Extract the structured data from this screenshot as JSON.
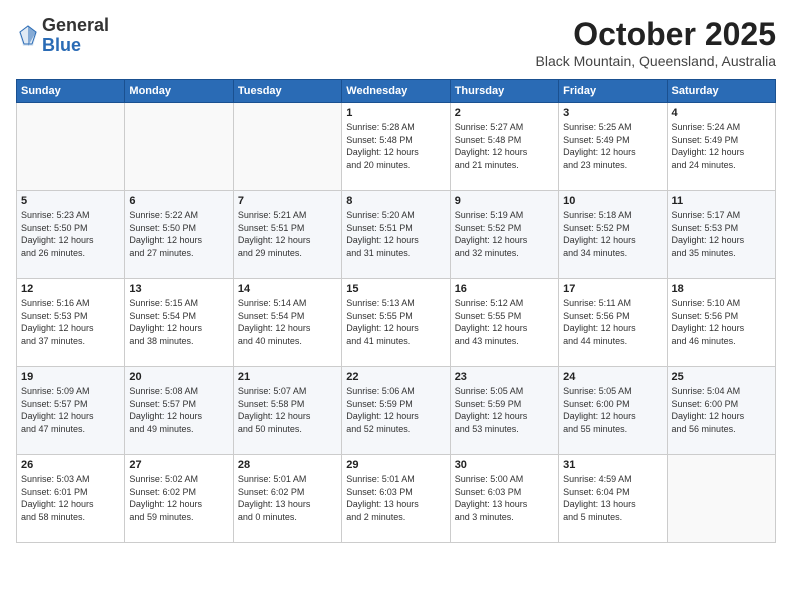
{
  "header": {
    "logo_general": "General",
    "logo_blue": "Blue",
    "month": "October 2025",
    "location": "Black Mountain, Queensland, Australia"
  },
  "days_of_week": [
    "Sunday",
    "Monday",
    "Tuesday",
    "Wednesday",
    "Thursday",
    "Friday",
    "Saturday"
  ],
  "weeks": [
    [
      {
        "day": "",
        "info": ""
      },
      {
        "day": "",
        "info": ""
      },
      {
        "day": "",
        "info": ""
      },
      {
        "day": "1",
        "info": "Sunrise: 5:28 AM\nSunset: 5:48 PM\nDaylight: 12 hours\nand 20 minutes."
      },
      {
        "day": "2",
        "info": "Sunrise: 5:27 AM\nSunset: 5:48 PM\nDaylight: 12 hours\nand 21 minutes."
      },
      {
        "day": "3",
        "info": "Sunrise: 5:25 AM\nSunset: 5:49 PM\nDaylight: 12 hours\nand 23 minutes."
      },
      {
        "day": "4",
        "info": "Sunrise: 5:24 AM\nSunset: 5:49 PM\nDaylight: 12 hours\nand 24 minutes."
      }
    ],
    [
      {
        "day": "5",
        "info": "Sunrise: 5:23 AM\nSunset: 5:50 PM\nDaylight: 12 hours\nand 26 minutes."
      },
      {
        "day": "6",
        "info": "Sunrise: 5:22 AM\nSunset: 5:50 PM\nDaylight: 12 hours\nand 27 minutes."
      },
      {
        "day": "7",
        "info": "Sunrise: 5:21 AM\nSunset: 5:51 PM\nDaylight: 12 hours\nand 29 minutes."
      },
      {
        "day": "8",
        "info": "Sunrise: 5:20 AM\nSunset: 5:51 PM\nDaylight: 12 hours\nand 31 minutes."
      },
      {
        "day": "9",
        "info": "Sunrise: 5:19 AM\nSunset: 5:52 PM\nDaylight: 12 hours\nand 32 minutes."
      },
      {
        "day": "10",
        "info": "Sunrise: 5:18 AM\nSunset: 5:52 PM\nDaylight: 12 hours\nand 34 minutes."
      },
      {
        "day": "11",
        "info": "Sunrise: 5:17 AM\nSunset: 5:53 PM\nDaylight: 12 hours\nand 35 minutes."
      }
    ],
    [
      {
        "day": "12",
        "info": "Sunrise: 5:16 AM\nSunset: 5:53 PM\nDaylight: 12 hours\nand 37 minutes."
      },
      {
        "day": "13",
        "info": "Sunrise: 5:15 AM\nSunset: 5:54 PM\nDaylight: 12 hours\nand 38 minutes."
      },
      {
        "day": "14",
        "info": "Sunrise: 5:14 AM\nSunset: 5:54 PM\nDaylight: 12 hours\nand 40 minutes."
      },
      {
        "day": "15",
        "info": "Sunrise: 5:13 AM\nSunset: 5:55 PM\nDaylight: 12 hours\nand 41 minutes."
      },
      {
        "day": "16",
        "info": "Sunrise: 5:12 AM\nSunset: 5:55 PM\nDaylight: 12 hours\nand 43 minutes."
      },
      {
        "day": "17",
        "info": "Sunrise: 5:11 AM\nSunset: 5:56 PM\nDaylight: 12 hours\nand 44 minutes."
      },
      {
        "day": "18",
        "info": "Sunrise: 5:10 AM\nSunset: 5:56 PM\nDaylight: 12 hours\nand 46 minutes."
      }
    ],
    [
      {
        "day": "19",
        "info": "Sunrise: 5:09 AM\nSunset: 5:57 PM\nDaylight: 12 hours\nand 47 minutes."
      },
      {
        "day": "20",
        "info": "Sunrise: 5:08 AM\nSunset: 5:57 PM\nDaylight: 12 hours\nand 49 minutes."
      },
      {
        "day": "21",
        "info": "Sunrise: 5:07 AM\nSunset: 5:58 PM\nDaylight: 12 hours\nand 50 minutes."
      },
      {
        "day": "22",
        "info": "Sunrise: 5:06 AM\nSunset: 5:59 PM\nDaylight: 12 hours\nand 52 minutes."
      },
      {
        "day": "23",
        "info": "Sunrise: 5:05 AM\nSunset: 5:59 PM\nDaylight: 12 hours\nand 53 minutes."
      },
      {
        "day": "24",
        "info": "Sunrise: 5:05 AM\nSunset: 6:00 PM\nDaylight: 12 hours\nand 55 minutes."
      },
      {
        "day": "25",
        "info": "Sunrise: 5:04 AM\nSunset: 6:00 PM\nDaylight: 12 hours\nand 56 minutes."
      }
    ],
    [
      {
        "day": "26",
        "info": "Sunrise: 5:03 AM\nSunset: 6:01 PM\nDaylight: 12 hours\nand 58 minutes."
      },
      {
        "day": "27",
        "info": "Sunrise: 5:02 AM\nSunset: 6:02 PM\nDaylight: 12 hours\nand 59 minutes."
      },
      {
        "day": "28",
        "info": "Sunrise: 5:01 AM\nSunset: 6:02 PM\nDaylight: 13 hours\nand 0 minutes."
      },
      {
        "day": "29",
        "info": "Sunrise: 5:01 AM\nSunset: 6:03 PM\nDaylight: 13 hours\nand 2 minutes."
      },
      {
        "day": "30",
        "info": "Sunrise: 5:00 AM\nSunset: 6:03 PM\nDaylight: 13 hours\nand 3 minutes."
      },
      {
        "day": "31",
        "info": "Sunrise: 4:59 AM\nSunset: 6:04 PM\nDaylight: 13 hours\nand 5 minutes."
      },
      {
        "day": "",
        "info": ""
      }
    ]
  ]
}
